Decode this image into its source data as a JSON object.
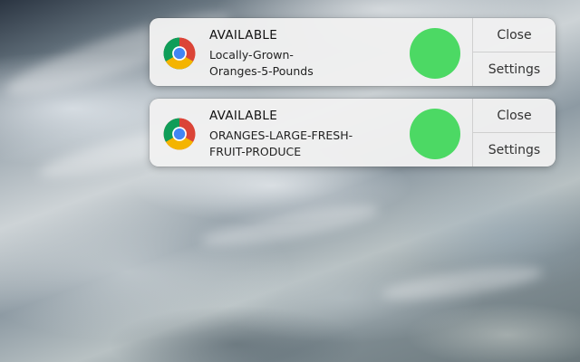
{
  "notifications": [
    {
      "app_icon": "chrome-icon",
      "title": "AVAILABLE",
      "message_line1": "Locally-Grown-",
      "message_line2": "Oranges-5-Pounds",
      "content_image": "green-circle",
      "content_image_color": "#4cd964",
      "actions": {
        "close_label": "Close",
        "settings_label": "Settings"
      }
    },
    {
      "app_icon": "chrome-icon",
      "title": "AVAILABLE",
      "message_line1": "ORANGES-LARGE-FRESH-",
      "message_line2": "FRUIT-PRODUCE",
      "content_image": "green-circle",
      "content_image_color": "#4cd964",
      "actions": {
        "close_label": "Close",
        "settings_label": "Settings"
      }
    }
  ]
}
